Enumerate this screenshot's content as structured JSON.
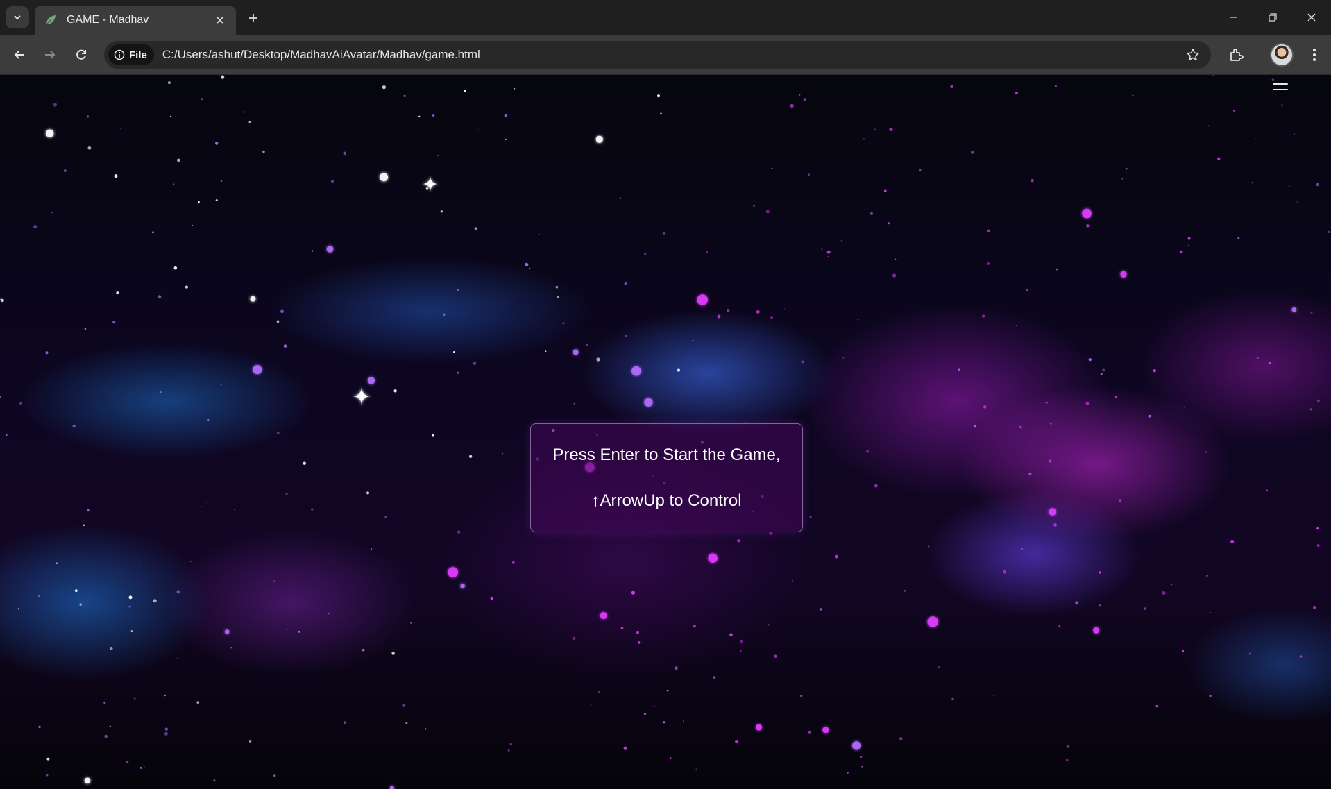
{
  "browser": {
    "tab_title": "GAME - Madhav",
    "address": {
      "chip_label": "File",
      "url": "C:/Users/ashut/Desktop/MadhavAiAvatar/Madhav/game.html"
    }
  },
  "game": {
    "start_line_1": "Press Enter to Start the Game,",
    "start_line_2": "↑ArrowUp to Control"
  },
  "colors": {
    "star_magenta": "#e13cff",
    "star_violet": "#b46cff",
    "star_white": "#ffffff"
  }
}
